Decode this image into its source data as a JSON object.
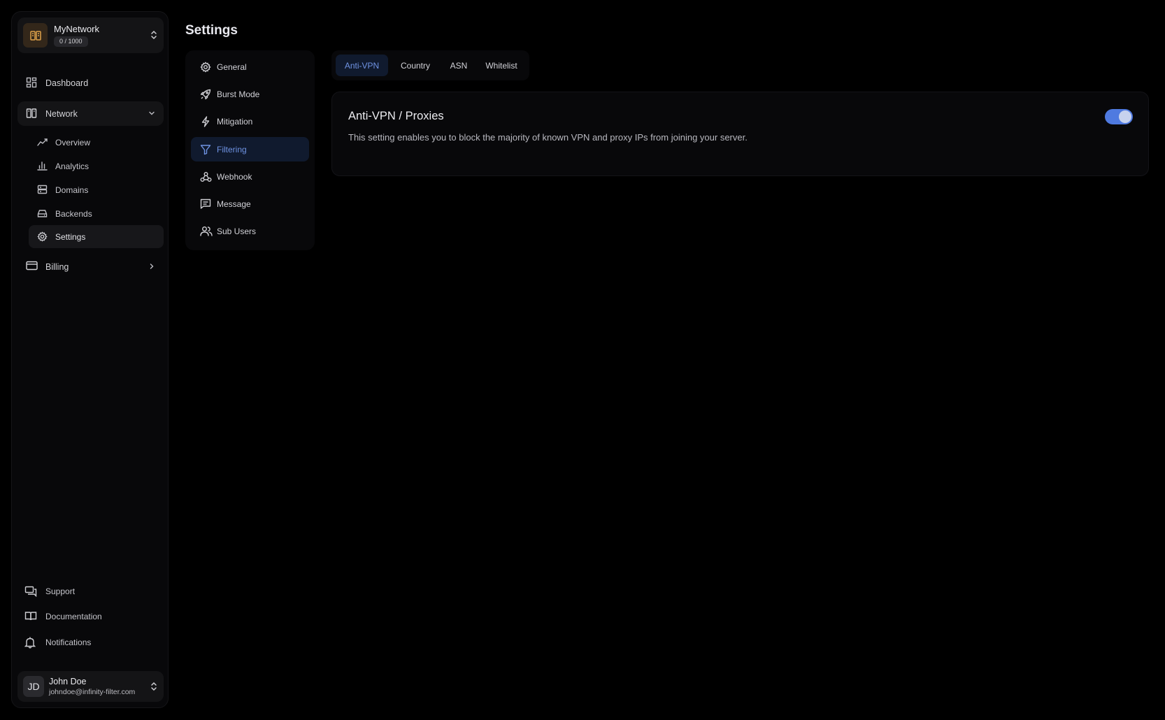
{
  "sidebar": {
    "network_switcher": {
      "name": "MyNetwork",
      "quota": "0 / 1000"
    },
    "nav": {
      "dashboard": "Dashboard",
      "network": "Network",
      "billing": "Billing"
    },
    "network_children": [
      {
        "label": "Overview",
        "icon": "chart-line-icon"
      },
      {
        "label": "Analytics",
        "icon": "bar-chart-icon"
      },
      {
        "label": "Domains",
        "icon": "server-icon"
      },
      {
        "label": "Backends",
        "icon": "drive-icon"
      },
      {
        "label": "Settings",
        "icon": "gear-icon",
        "active": true
      }
    ],
    "footer": {
      "support": "Support",
      "documentation": "Documentation",
      "notifications": "Notifications"
    },
    "user": {
      "initials": "JD",
      "name": "John Doe",
      "email": "johndoe@infinity-filter.com"
    }
  },
  "page": {
    "title": "Settings"
  },
  "settings_nav": [
    {
      "label": "General",
      "icon": "gear-icon"
    },
    {
      "label": "Burst Mode",
      "icon": "rocket-icon"
    },
    {
      "label": "Mitigation",
      "icon": "lightning-icon"
    },
    {
      "label": "Filtering",
      "icon": "filter-icon",
      "active": true
    },
    {
      "label": "Webhook",
      "icon": "webhook-icon"
    },
    {
      "label": "Message",
      "icon": "message-icon"
    },
    {
      "label": "Sub Users",
      "icon": "users-icon"
    }
  ],
  "tabs": [
    {
      "label": "Anti-VPN",
      "active": true
    },
    {
      "label": "Country"
    },
    {
      "label": "ASN"
    },
    {
      "label": "Whitelist"
    }
  ],
  "card": {
    "title": "Anti-VPN / Proxies",
    "description": "This setting enables you to block the majority of known VPN and proxy IPs from joining your server.",
    "enabled": true
  },
  "colors": {
    "accent": "#4f7ae0",
    "accent_text": "#6f93e3",
    "logo_tint": "#e0a24a"
  }
}
